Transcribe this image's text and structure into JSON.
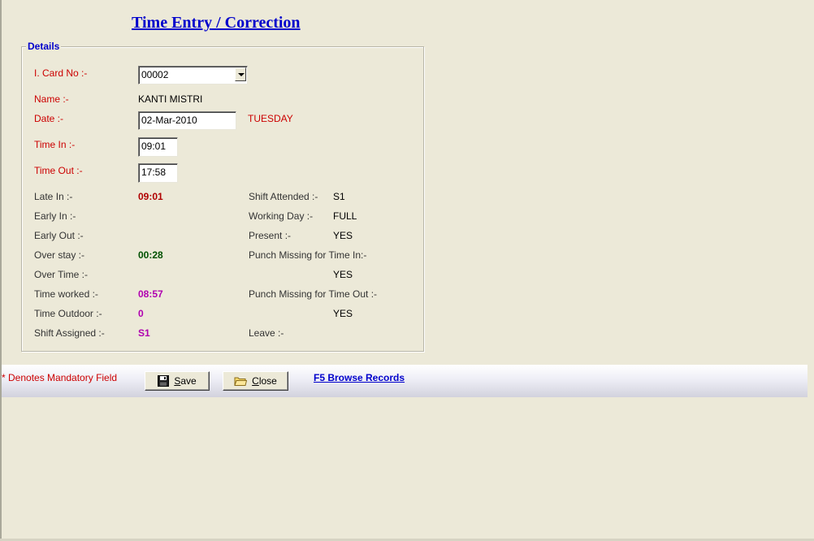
{
  "page_title": "Time Entry / Correction",
  "details": {
    "legend": "Details",
    "card_no": {
      "label": "I. Card No :-",
      "value": "00002"
    },
    "name": {
      "label": "Name :-",
      "value": "KANTI MISTRI"
    },
    "date": {
      "label": "Date :-",
      "value": "02-Mar-2010",
      "day": "TUESDAY"
    },
    "time_in": {
      "label": "Time In :-",
      "value": "09:01"
    },
    "time_out": {
      "label": "Time Out :-",
      "value": "17:58"
    },
    "late_in": {
      "label": "Late In :-",
      "value": "09:01"
    },
    "early_in": {
      "label": "Early In :-",
      "value": ""
    },
    "early_out": {
      "label": "Early Out :-",
      "value": ""
    },
    "over_stay": {
      "label": "Over stay :-",
      "value": "00:28"
    },
    "over_time": {
      "label": "Over Time :-",
      "value": ""
    },
    "time_worked": {
      "label": "Time worked :-",
      "value": "08:57"
    },
    "time_outdoor": {
      "label": "Time Outdoor :-",
      "value": "0"
    },
    "shift_assigned": {
      "label": "Shift Assigned :-",
      "value": "S1"
    },
    "shift_attended": {
      "label": "Shift Attended :-",
      "value": "S1"
    },
    "working_day": {
      "label": "Working Day :-",
      "value": "FULL"
    },
    "present": {
      "label": "Present :-",
      "value": "YES"
    },
    "punch_missing_in": {
      "label": "Punch Missing for Time In:-",
      "value": "YES"
    },
    "punch_missing_out": {
      "label": "Punch Missing for Time Out :-",
      "value": "YES"
    },
    "leave": {
      "label": "Leave :-",
      "value": ""
    }
  },
  "footer": {
    "mandatory_note": "* Denotes Mandatory Field",
    "save_prefix": "S",
    "save_rest": "ave",
    "close_prefix": "C",
    "close_rest": "lose",
    "browse_link": "F5 Browse Records"
  },
  "colors": {
    "background": "#ece9d8",
    "title_blue": "#0000cc",
    "mandatory_red": "#cc0000",
    "late_in_red": "#b00000",
    "over_stay_green": "#005000",
    "purple_values": "#b000b0"
  },
  "icons": {
    "save": "floppy-disk-icon",
    "close": "folder-icon",
    "card_dropdown": "chevron-down-icon"
  }
}
